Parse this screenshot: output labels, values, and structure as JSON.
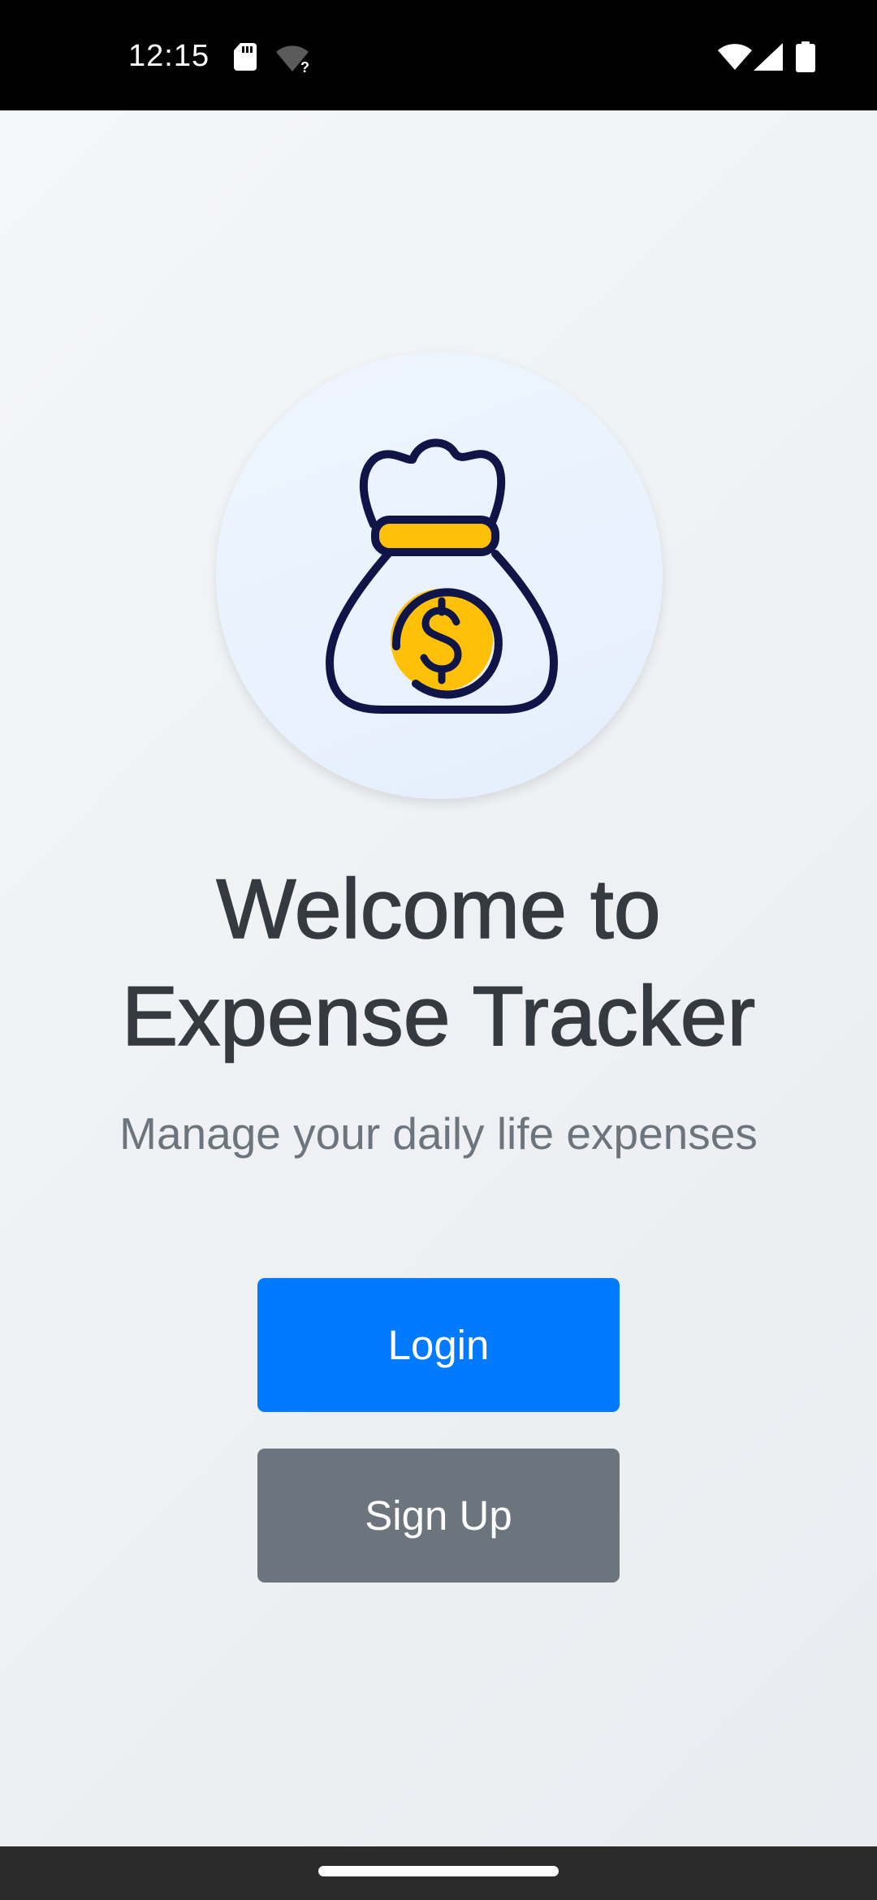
{
  "status_bar": {
    "time": "12:15",
    "icons": [
      "sd-card-icon",
      "wifi-unknown-icon",
      "wifi-icon",
      "cell-signal-icon",
      "battery-icon"
    ]
  },
  "logo": {
    "icon": "money-bag-dollar-icon",
    "colors": {
      "outline": "#0f1546",
      "accent": "#ffc107",
      "circle": "#e8f1fd"
    }
  },
  "welcome": {
    "title_line1": "Welcome to",
    "title_line2": "Expense Tracker",
    "subtitle": "Manage your daily life expenses"
  },
  "buttons": {
    "login_label": "Login",
    "signup_label": "Sign Up"
  },
  "colors": {
    "primary": "#007bff",
    "secondary": "#6c757d",
    "title": "#343a40"
  }
}
